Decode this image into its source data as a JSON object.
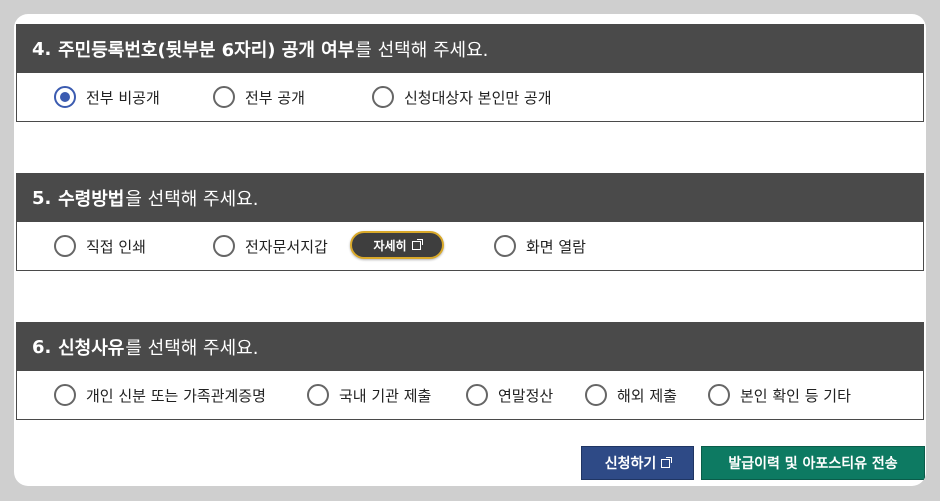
{
  "sections": [
    {
      "number": "4.",
      "title_bold": "주민등록번호(뒷부분 6자리) 공개 여부",
      "title_rest": "를 선택해 주세요.",
      "options": [
        {
          "label": "전부 비공개",
          "checked": true
        },
        {
          "label": "전부 공개",
          "checked": false
        },
        {
          "label": "신청대상자 본인만 공개",
          "checked": false
        }
      ]
    },
    {
      "number": "5.",
      "title_bold": "수령방법",
      "title_rest": "을 선택해 주세요.",
      "options": [
        {
          "label": "직접 인쇄",
          "checked": false
        },
        {
          "label": "전자문서지갑",
          "checked": false
        },
        {
          "label": "화면 열람",
          "checked": false
        }
      ],
      "detail_button": "자세히"
    },
    {
      "number": "6.",
      "title_bold": "신청사유",
      "title_rest": "를 선택해 주세요.",
      "options": [
        {
          "label": "개인 신분 또는 가족관계증명",
          "checked": false
        },
        {
          "label": "국내 기관 제출",
          "checked": false
        },
        {
          "label": "연말정산",
          "checked": false
        },
        {
          "label": "해외 제출",
          "checked": false
        },
        {
          "label": "본인 확인 등 기타",
          "checked": false
        }
      ]
    }
  ],
  "buttons": {
    "apply": "신청하기",
    "send": "발급이력 및 아포스티유 전송"
  },
  "colors": {
    "header_bg": "#4a4a4a",
    "radio_checked": "#3b5bb0",
    "apply_bg": "#2e4a86",
    "send_bg": "#0d7a62",
    "detail_border": "#d9a92a"
  }
}
